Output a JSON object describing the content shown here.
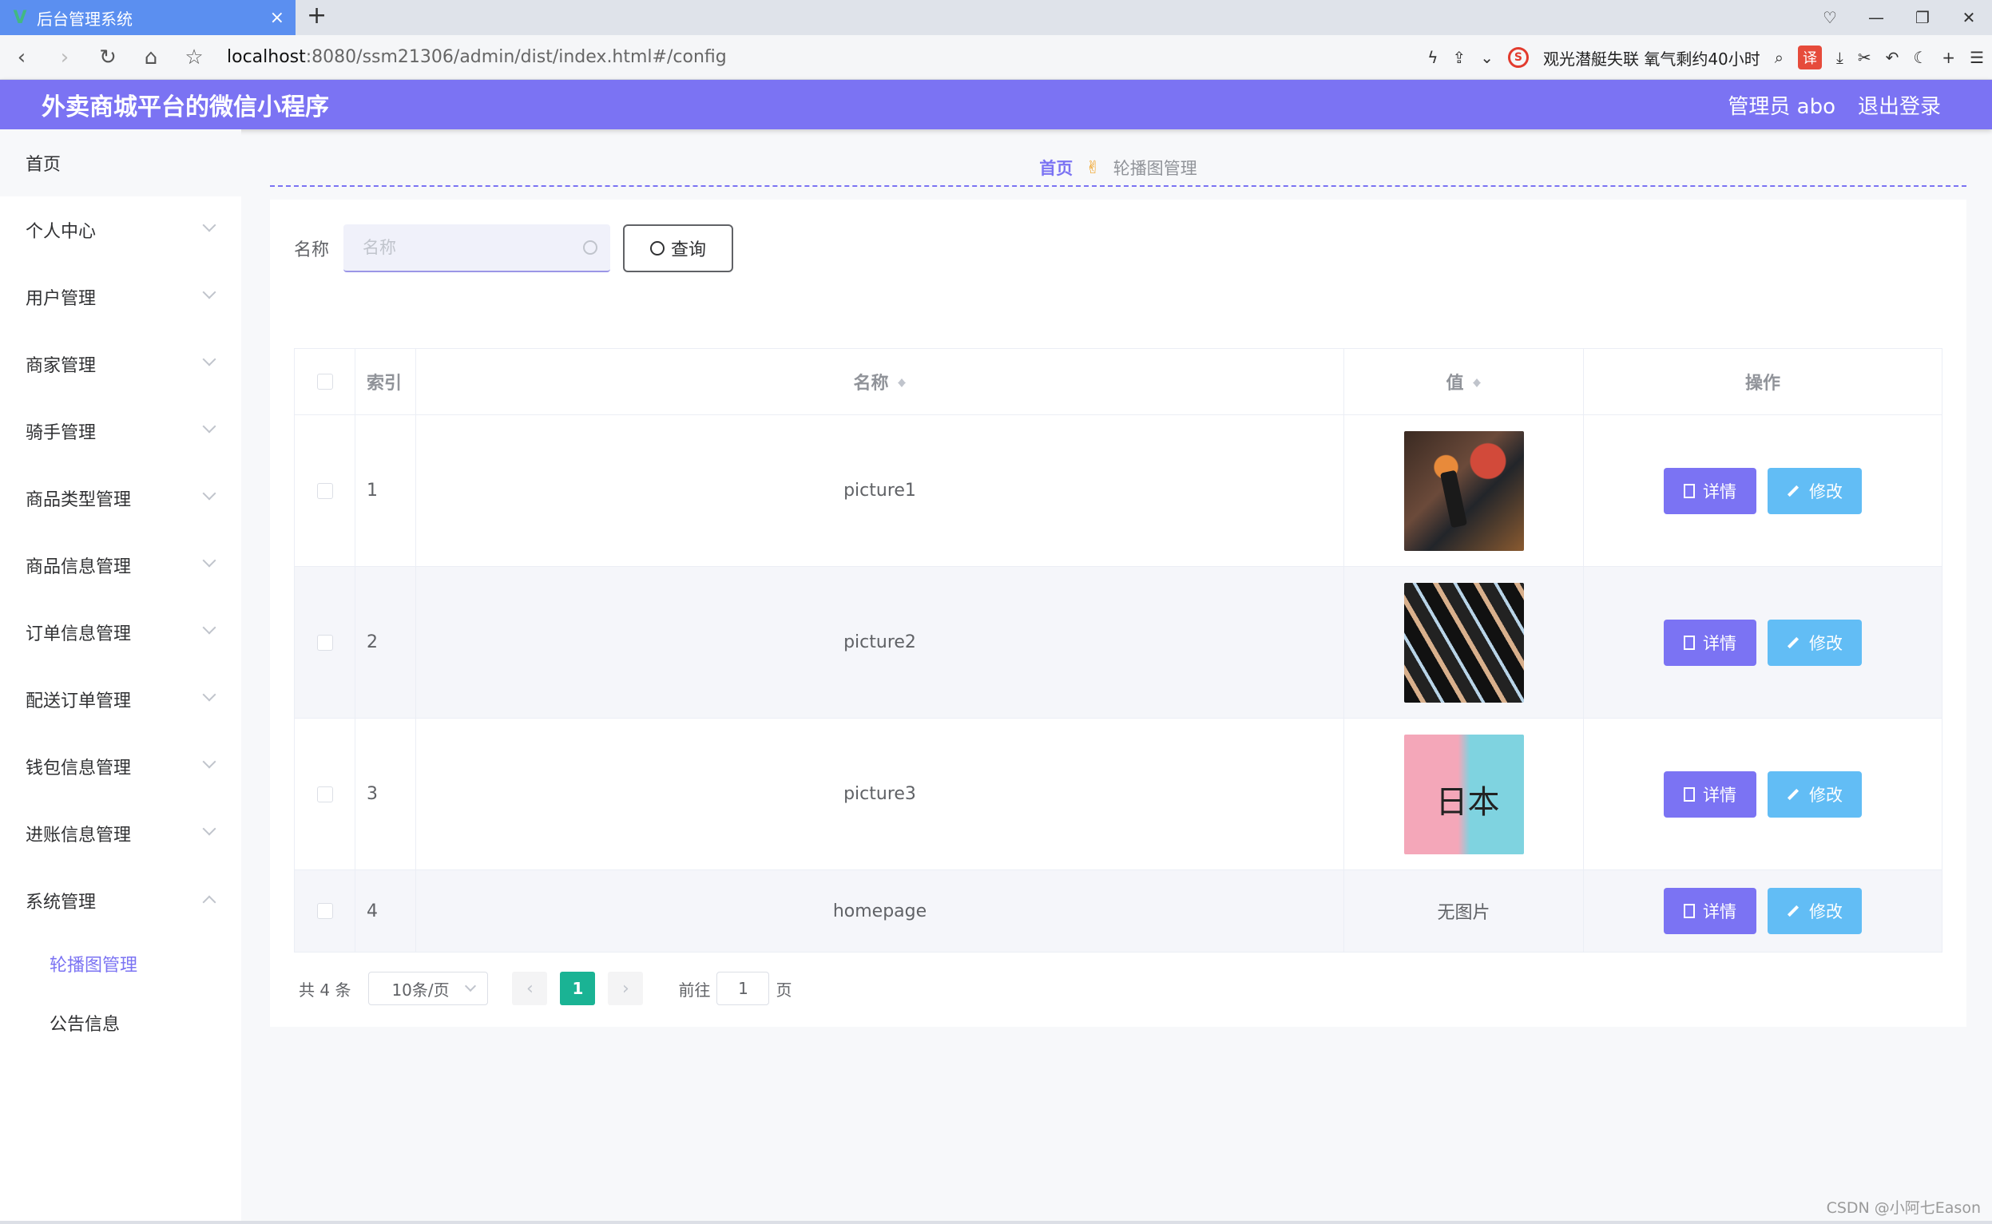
{
  "browser": {
    "tab_title": "后台管理系统",
    "url_host": "localhost",
    "url_rest": ":8080/ssm21306/admin/dist/index.html#/config",
    "news": "观光潜艇失联 氧气剩约40小时",
    "translate_label": "译"
  },
  "header": {
    "title": "外卖商城平台的微信小程序",
    "user": "管理员 abo",
    "logout": "退出登录"
  },
  "sidebar": {
    "home": "首页",
    "items": [
      {
        "label": "个人中心"
      },
      {
        "label": "用户管理"
      },
      {
        "label": "商家管理"
      },
      {
        "label": "骑手管理"
      },
      {
        "label": "商品类型管理"
      },
      {
        "label": "商品信息管理"
      },
      {
        "label": "订单信息管理"
      },
      {
        "label": "配送订单管理"
      },
      {
        "label": "钱包信息管理"
      },
      {
        "label": "进账信息管理"
      },
      {
        "label": "系统管理"
      }
    ],
    "subitems": [
      {
        "label": "轮播图管理",
        "active": true
      },
      {
        "label": "公告信息",
        "active": false
      }
    ]
  },
  "breadcrumb": {
    "home": "首页",
    "current": "轮播图管理"
  },
  "search": {
    "label": "名称",
    "placeholder": "名称",
    "button": "查询"
  },
  "table": {
    "headers": [
      "索引",
      "名称",
      "值",
      "操作"
    ],
    "rows": [
      {
        "index": "1",
        "name": "picture1",
        "value": "",
        "image": "thumb1"
      },
      {
        "index": "2",
        "name": "picture2",
        "value": "",
        "image": "thumb2"
      },
      {
        "index": "3",
        "name": "picture3",
        "value": "",
        "image": "thumb3"
      },
      {
        "index": "4",
        "name": "homepage",
        "value": "无图片",
        "image": ""
      }
    ],
    "detail_label": "详情",
    "edit_label": "修改"
  },
  "pagination": {
    "total": "共 4 条",
    "page_size": "10条/页",
    "current_page": "1",
    "goto_label": "前往",
    "goto_value": "1",
    "page_suffix": "页"
  },
  "watermark": "CSDN @小阿七Eason",
  "colors": {
    "accent": "#7b73f3",
    "edit": "#62bdf5",
    "pager_active": "#1ab394"
  }
}
